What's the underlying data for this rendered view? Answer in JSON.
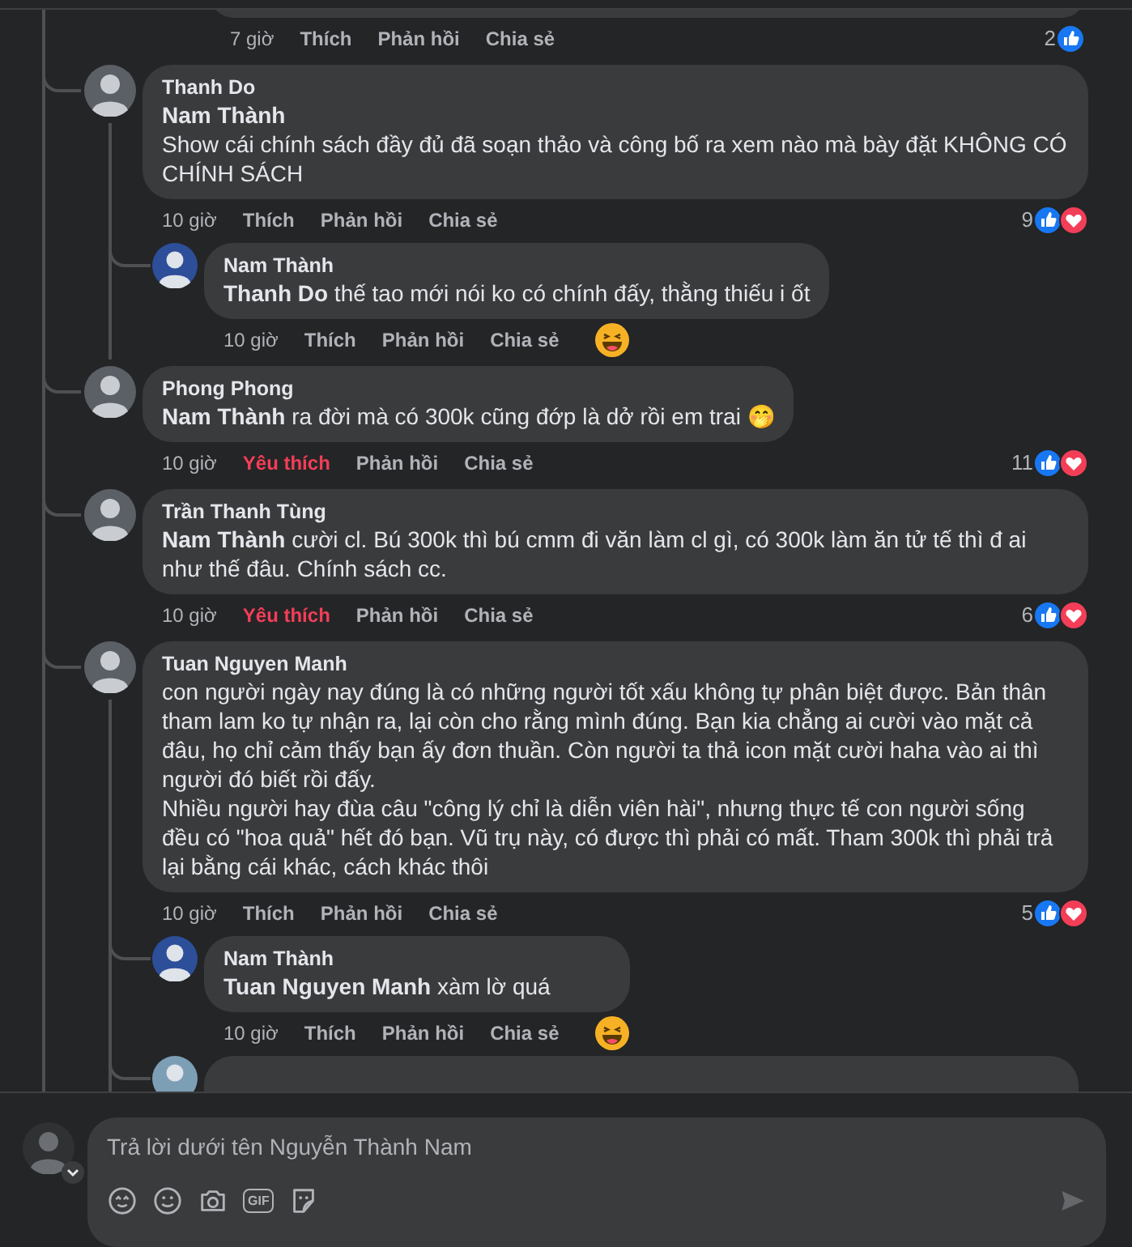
{
  "top_comment": {
    "time": "7 giờ",
    "like_label": "Thích",
    "reply_label": "Phản hồi",
    "share_label": "Chia sẻ",
    "loved": false,
    "reaction_count": "2",
    "reactions": [
      {
        "kind": "like"
      }
    ]
  },
  "comments": [
    {
      "author": "Thanh Do",
      "text": "**Nam Thành**\nShow cái chính sách đầy đủ đã soạn thảo và công bố ra xem nào mà bày đặt KHÔNG CÓ CHÍNH SÁCH",
      "time": "10 giờ",
      "like_label": "Thích",
      "reply_label": "Phản hồi",
      "share_label": "Chia sẻ",
      "loved": false,
      "reaction_count": "9",
      "reactions": [
        {
          "kind": "like"
        },
        {
          "kind": "love"
        }
      ],
      "children": [
        {
          "author": "Nam Thành",
          "text": "**Thanh Do** thế tao mới nói ko có chính đấy, thằng thiếu i ốt",
          "time": "10 giờ",
          "like_label": "Thích",
          "reply_label": "Phản hồi",
          "share_label": "Chia sẻ",
          "loved": false,
          "reactions": [
            {
              "kind": "haha"
            }
          ]
        }
      ]
    },
    {
      "author": "Phong Phong",
      "text": "**Nam Thành** ra đời mà có 300k cũng đớp là dở rồi em trai 🤭",
      "time": "10 giờ",
      "like_label": "Yêu thích",
      "reply_label": "Phản hồi",
      "share_label": "Chia sẻ",
      "loved": true,
      "reaction_count": "11",
      "reactions": [
        {
          "kind": "like"
        },
        {
          "kind": "love"
        }
      ]
    },
    {
      "author": "Trần Thanh Tùng",
      "text": "**Nam Thành** cười cl. Bú 300k thì bú cmm đi văn làm cl gì, có 300k làm ăn tử tế thì đ ai như thế đâu. Chính sách cc.",
      "time": "10 giờ",
      "like_label": "Yêu thích",
      "reply_label": "Phản hồi",
      "share_label": "Chia sẻ",
      "loved": true,
      "reaction_count": "6",
      "reactions": [
        {
          "kind": "like"
        },
        {
          "kind": "love"
        }
      ]
    },
    {
      "author": "Tuan Nguyen Manh",
      "text": "con người ngày nay đúng là có những người tốt xấu không tự phân biệt được. Bản thân tham lam ko tự nhận ra, lại còn cho rằng mình đúng. Bạn kia chẳng ai cười vào mặt cả đâu, họ chỉ cảm thấy bạn ấy đơn thuần. Còn người ta thả icon mặt cười haha vào ai thì người đó biết rồi đấy.\nNhiều người hay đùa câu \"công lý chỉ là diễn viên hài\", nhưng thực tế con người sống đều có \"hoa quả\" hết đó bạn. Vũ trụ này, có được thì phải có mất. Tham 300k thì phải trả lại bằng cái khác, cách khác thôi",
      "time": "10 giờ",
      "like_label": "Thích",
      "reply_label": "Phản hồi",
      "share_label": "Chia sẻ",
      "loved": false,
      "reaction_count": "5",
      "reactions": [
        {
          "kind": "like"
        },
        {
          "kind": "love"
        }
      ],
      "more_replies": true,
      "children": [
        {
          "author": "Nam Thành",
          "text": "**Tuan Nguyen Manh** xàm lờ quá",
          "time": "10 giờ",
          "like_label": "Thích",
          "reply_label": "Phản hồi",
          "share_label": "Chia sẻ",
          "loved": false,
          "reactions": [
            {
              "kind": "haha"
            }
          ]
        }
      ]
    }
  ],
  "composer": {
    "placeholder": "Trả lời dưới tên Nguyễn Thành Nam",
    "gif_label": "GIF"
  }
}
